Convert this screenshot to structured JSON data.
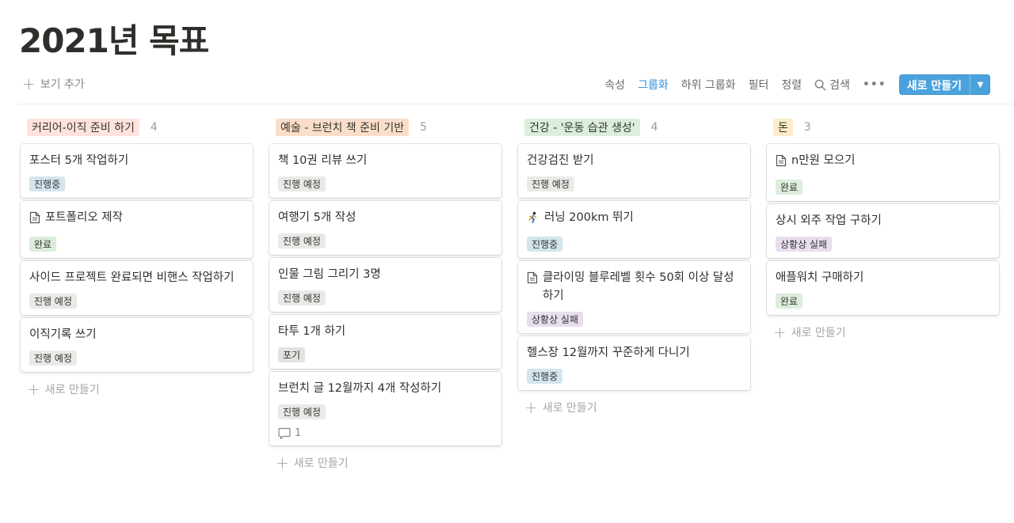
{
  "page": {
    "title": "2021년 목표"
  },
  "toolbar": {
    "add_view": "보기 추가",
    "properties": "속성",
    "group": "그룹화",
    "subgroup": "하위 그룹화",
    "filter": "필터",
    "sort": "정렬",
    "search": "검색",
    "new_button": "새로 만들기"
  },
  "colors": {
    "accent": "#2e8fd6",
    "button": "#4aa2dd",
    "status_in_progress": "#d3e5ef",
    "status_planned": "#e9e9e7",
    "status_done": "#dbeddb",
    "status_failed": "#e8deee",
    "status_gave_up": "#e3e2e0"
  },
  "columns": [
    {
      "name": "커리어-이직 준비 하기",
      "count": "4",
      "color": "#ffe2dd",
      "add_label": "새로 만들기",
      "cards": [
        {
          "title": "포스터 5개 작업하기",
          "icon": "",
          "status": "진행중",
          "status_color": "#d3e5ef"
        },
        {
          "title": "포트폴리오 제작",
          "icon": "page-icon",
          "status": "완료",
          "status_color": "#dbeddb"
        },
        {
          "title": "사이드 프로젝트 완료되면 비핸스 작업하기",
          "icon": "",
          "status": "진행 예정",
          "status_color": "#e9e9e7"
        },
        {
          "title": "이직기록 쓰기",
          "icon": "",
          "status": "진행 예정",
          "status_color": "#e9e9e7"
        }
      ]
    },
    {
      "name": "예술 - 브런치 책 준비 기반",
      "count": "5",
      "color": "#fadec9",
      "add_label": "새로 만들기",
      "cards": [
        {
          "title": "책 10권 리뷰 쓰기",
          "icon": "",
          "status": "진행 예정",
          "status_color": "#e9e9e7"
        },
        {
          "title": "여행기 5개 작성",
          "icon": "",
          "status": "진행 예정",
          "status_color": "#e9e9e7"
        },
        {
          "title": "인물 그림 그리기 3명",
          "icon": "",
          "status": "진행 예정",
          "status_color": "#e9e9e7"
        },
        {
          "title": "타투 1개 하기",
          "icon": "",
          "status": "포기",
          "status_color": "#e3e2e0"
        },
        {
          "title": "브런치 글 12월까지 4개 작성하기",
          "icon": "",
          "status": "진행 예정",
          "status_color": "#e9e9e7",
          "comments": "1"
        }
      ]
    },
    {
      "name": "건강 - '운동 습관 생성'",
      "count": "4",
      "color": "#dbeddb",
      "add_label": "새로 만들기",
      "cards": [
        {
          "title": "건강검진 받기",
          "icon": "",
          "status": "진행 예정",
          "status_color": "#e9e9e7"
        },
        {
          "title": "러닝 200km 뛰기",
          "icon": "runner-icon",
          "status": "진행중",
          "status_color": "#d3e5ef"
        },
        {
          "title": "클라이밍 블루레벨 횟수 50회 이상 달성하기",
          "icon": "page-icon",
          "status": "상황상 실패",
          "status_color": "#e8deee"
        },
        {
          "title": "헬스장 12월까지 꾸준하게 다니기",
          "icon": "",
          "status": "진행중",
          "status_color": "#d3e5ef"
        }
      ]
    },
    {
      "name": "돈",
      "count": "3",
      "color": "#fdecc8",
      "add_label": "새로 만들기",
      "cards": [
        {
          "title": "n만원 모으기",
          "icon": "page-icon",
          "status": "완료",
          "status_color": "#dbeddb"
        },
        {
          "title": "상시 외주 작업 구하기",
          "icon": "",
          "status": "상황상 실패",
          "status_color": "#e8deee"
        },
        {
          "title": "애플워치 구매하기",
          "icon": "",
          "status": "완료",
          "status_color": "#dbeddb"
        }
      ]
    }
  ]
}
